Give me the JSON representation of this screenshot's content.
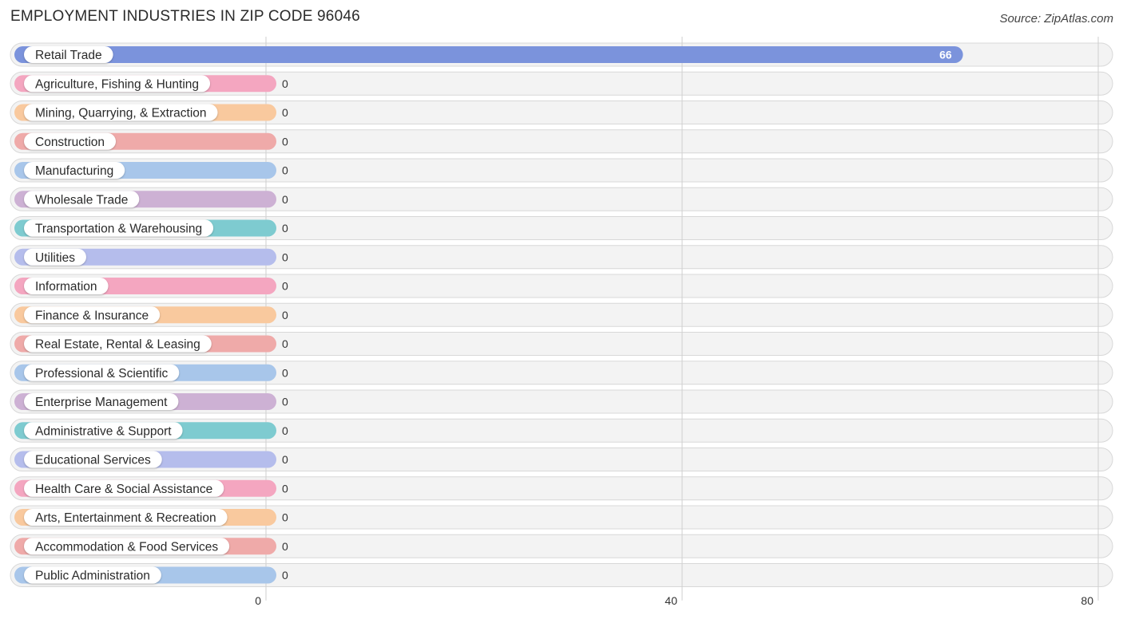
{
  "chart_data": {
    "type": "bar",
    "orientation": "horizontal",
    "title": "EMPLOYMENT INDUSTRIES IN ZIP CODE 96046",
    "source": "Source: ZipAtlas.com",
    "xlabel": "",
    "ylabel": "",
    "xlim": [
      0,
      80
    ],
    "xticks": [
      0,
      40,
      80
    ],
    "grid": true,
    "categories": [
      "Retail Trade",
      "Agriculture, Fishing & Hunting",
      "Mining, Quarrying, & Extraction",
      "Construction",
      "Manufacturing",
      "Wholesale Trade",
      "Transportation & Warehousing",
      "Utilities",
      "Information",
      "Finance & Insurance",
      "Real Estate, Rental & Leasing",
      "Professional & Scientific",
      "Enterprise Management",
      "Administrative & Support",
      "Educational Services",
      "Health Care & Social Assistance",
      "Arts, Entertainment & Recreation",
      "Accommodation & Food Services",
      "Public Administration"
    ],
    "values": [
      66,
      0,
      0,
      0,
      0,
      0,
      0,
      0,
      0,
      0,
      0,
      0,
      0,
      0,
      0,
      0,
      0,
      0,
      0
    ],
    "colors": [
      "#7b93dc",
      "#f4a6c0",
      "#f9c99e",
      "#efaaa9",
      "#a8c6ea",
      "#cdb1d4",
      "#7ecbd0",
      "#b5bdec",
      "#f4a6c0",
      "#f9c99e",
      "#efaaa9",
      "#a8c6ea",
      "#cdb1d4",
      "#7ecbd0",
      "#b5bdec",
      "#f4a6c0",
      "#f9c99e",
      "#efaaa9",
      "#a8c6ea"
    ]
  }
}
